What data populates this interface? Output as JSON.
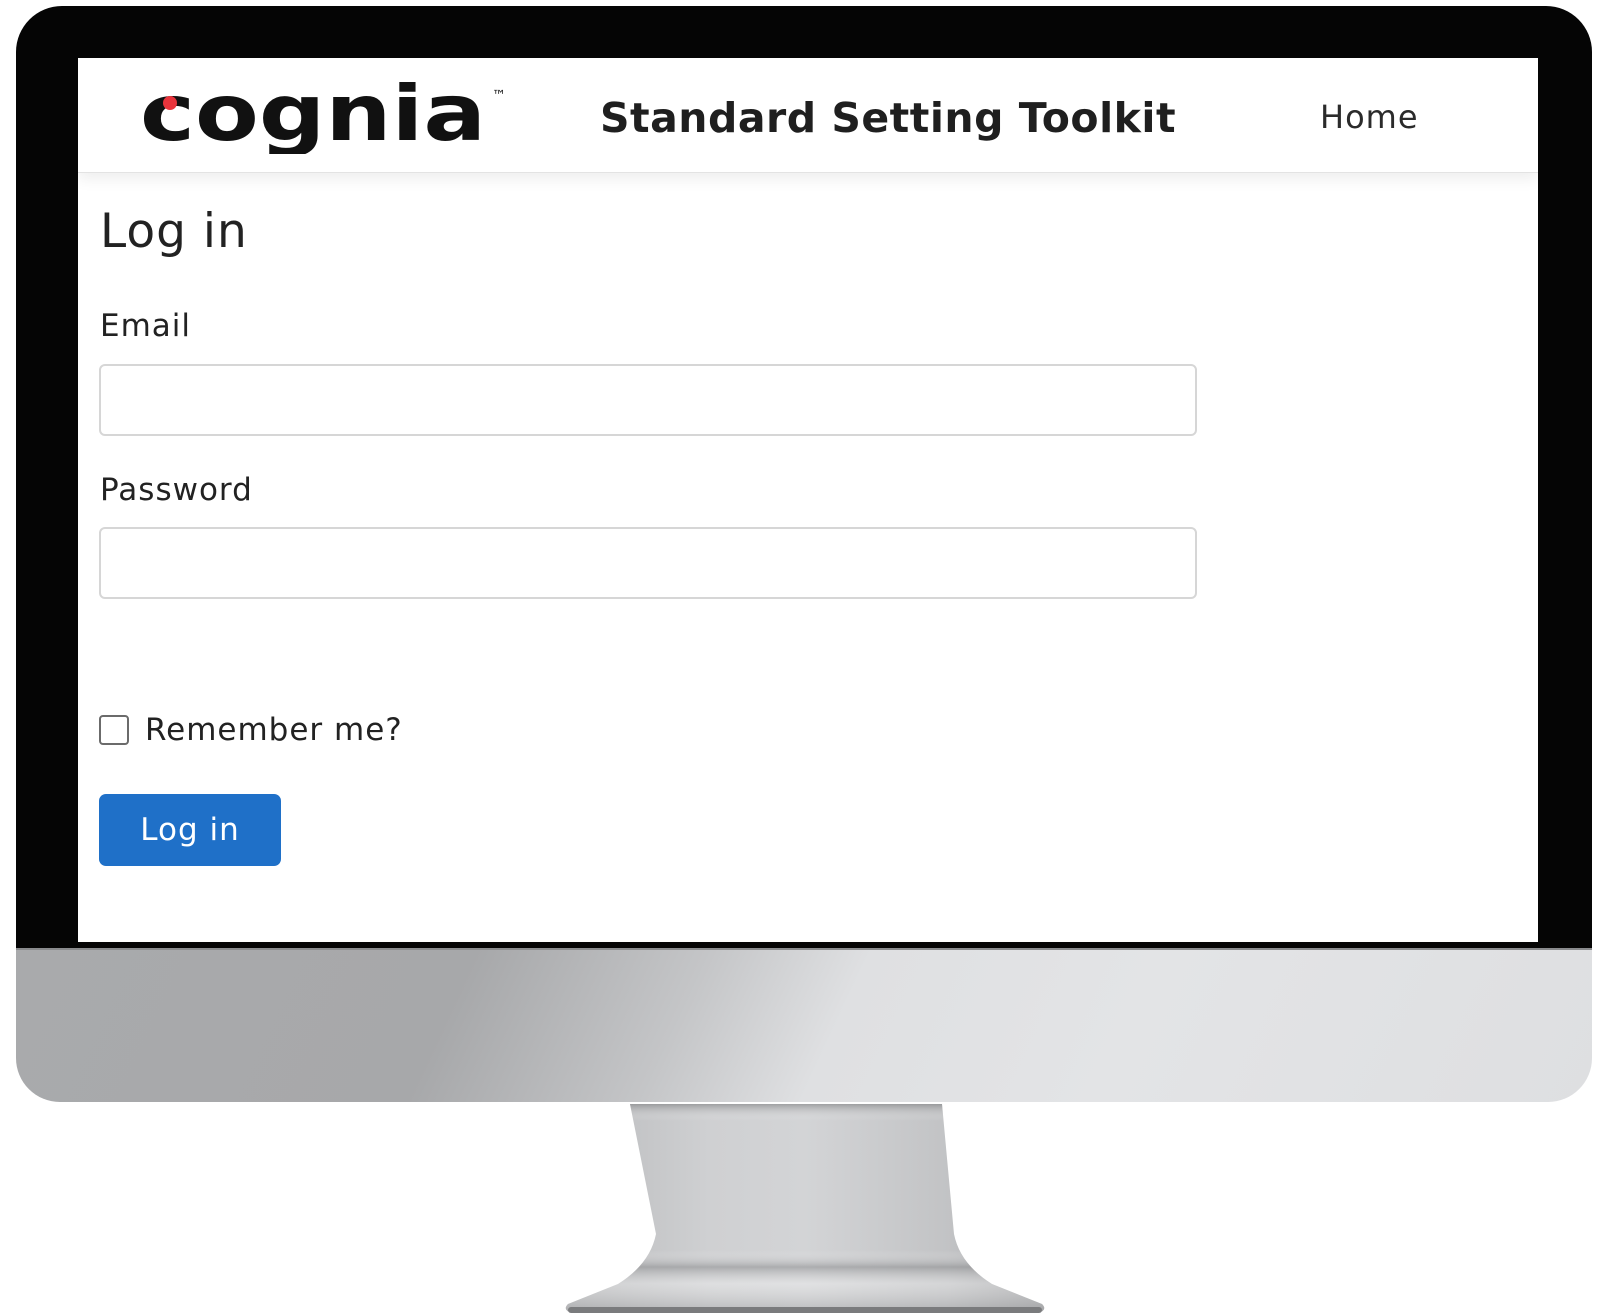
{
  "header": {
    "logo_text": "cognia",
    "logo_trademark": "™",
    "app_title": "Standard Setting Toolkit",
    "nav_home": "Home"
  },
  "login": {
    "heading": "Log in",
    "email_label": "Email",
    "email_value": "",
    "password_label": "Password",
    "password_value": "",
    "remember_label": "Remember me?",
    "remember_checked": false,
    "submit_label": "Log in"
  },
  "colors": {
    "primary_button": "#1f70c8",
    "logo_dot": "#e8343c",
    "bezel": "#050505"
  }
}
